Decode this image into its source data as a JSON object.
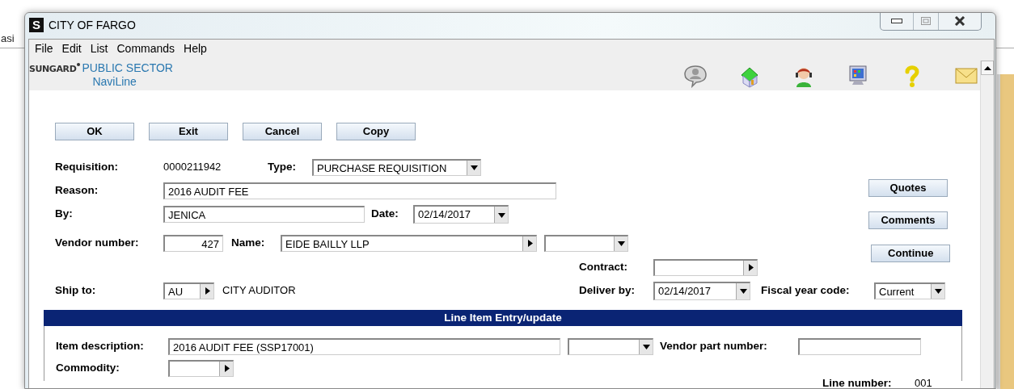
{
  "background": {
    "bookmark_text": "asi"
  },
  "window": {
    "icon_letter": "S",
    "title": "CITY OF FARGO"
  },
  "menu": [
    {
      "label": "File"
    },
    {
      "label": "Edit"
    },
    {
      "label": "List"
    },
    {
      "label": "Commands"
    },
    {
      "label": "Help"
    }
  ],
  "brand": {
    "company": "SUNGARD",
    "division": "PUBLIC SECTOR",
    "product": "NaviLine"
  },
  "actions": [
    "OK",
    "Exit",
    "Cancel",
    "Copy"
  ],
  "side_actions": [
    "Quotes",
    "Comments",
    "Continue"
  ],
  "fields": {
    "requisition": {
      "label": "Requisition:",
      "value": "0000211942",
      "kind": "static"
    },
    "type": {
      "label": "Type:",
      "value": "PURCHASE REQUISITION",
      "kind": "dropdown"
    },
    "reason": {
      "label": "Reason:",
      "value": "2016 AUDIT FEE",
      "kind": "text"
    },
    "by": {
      "label": "By:",
      "value": "JENICA",
      "kind": "text"
    },
    "date": {
      "label": "Date:",
      "value": "02/14/2017",
      "kind": "dropdown"
    },
    "vendor_number": {
      "label": "Vendor number:",
      "value": "427",
      "kind": "text"
    },
    "name": {
      "label": "Name:",
      "value": "EIDE BAILLY LLP",
      "kind": "lookup"
    },
    "name_option": {
      "kind": "dropdown"
    },
    "contract": {
      "label": "Contract:",
      "kind": "lookup"
    },
    "ship_to": {
      "label": "Ship to:",
      "value": "AU",
      "kind": "lookup"
    },
    "ship_to_name": {
      "value": "CITY AUDITOR",
      "kind": "static"
    },
    "deliver_by": {
      "label": "Deliver by:",
      "value": "02/14/2017",
      "kind": "dropdown"
    },
    "fiscal_year_code": {
      "label": "Fiscal year code:",
      "value": "Current",
      "kind": "dropdown"
    }
  },
  "line_item": {
    "title": "Line Item Entry/update",
    "fields": {
      "item_description": {
        "label": "Item description:",
        "value": "2016 AUDIT FEE (SSP17001)",
        "kind": "text"
      },
      "item_option": {
        "kind": "dropdown"
      },
      "vendor_part_number": {
        "label": "Vendor part number:",
        "kind": "text"
      },
      "commodity": {
        "label": "Commodity:",
        "kind": "lookup"
      },
      "line_number": {
        "label": "Line number:",
        "value": "001",
        "kind": "static"
      }
    }
  }
}
